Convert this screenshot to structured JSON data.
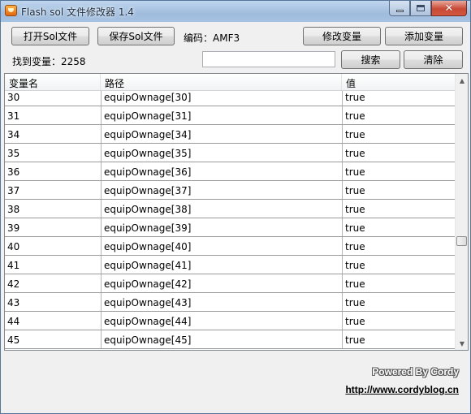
{
  "window": {
    "title": "Flash sol 文件修改器 1.4",
    "controls": {
      "minimize": "–",
      "maximize": "□",
      "close": "✕"
    }
  },
  "toolbar": {
    "open_label": "打开Sol文件",
    "save_label": "保存Sol文件",
    "encoding_label": "编码：AMF3",
    "modify_label": "修改变量",
    "add_label": "添加变量",
    "found_label": "找到变量：2258",
    "search_label": "搜索",
    "clear_label": "清除",
    "search_value": ""
  },
  "table": {
    "columns": [
      "变量名",
      "路径",
      "值"
    ],
    "rows": [
      {
        "name": "30",
        "path": "equipOwnage[30]",
        "value": "true"
      },
      {
        "name": "31",
        "path": "equipOwnage[31]",
        "value": "true"
      },
      {
        "name": "34",
        "path": "equipOwnage[34]",
        "value": "true"
      },
      {
        "name": "35",
        "path": "equipOwnage[35]",
        "value": "true"
      },
      {
        "name": "36",
        "path": "equipOwnage[36]",
        "value": "true"
      },
      {
        "name": "37",
        "path": "equipOwnage[37]",
        "value": "true"
      },
      {
        "name": "38",
        "path": "equipOwnage[38]",
        "value": "true"
      },
      {
        "name": "39",
        "path": "equipOwnage[39]",
        "value": "true"
      },
      {
        "name": "40",
        "path": "equipOwnage[40]",
        "value": "true"
      },
      {
        "name": "41",
        "path": "equipOwnage[41]",
        "value": "true"
      },
      {
        "name": "42",
        "path": "equipOwnage[42]",
        "value": "true"
      },
      {
        "name": "43",
        "path": "equipOwnage[43]",
        "value": "true"
      },
      {
        "name": "44",
        "path": "equipOwnage[44]",
        "value": "true"
      },
      {
        "name": "45",
        "path": "equipOwnage[45]",
        "value": "true"
      }
    ],
    "scroll_position": 0.62
  },
  "footer": {
    "powered_by": "Powered By Cordy",
    "url": "http://www.cordyblog.cn"
  },
  "colors": {
    "titlebar": "#a6c2e2",
    "close_button": "#c84a36",
    "grid_line": "#9a9a9a"
  }
}
